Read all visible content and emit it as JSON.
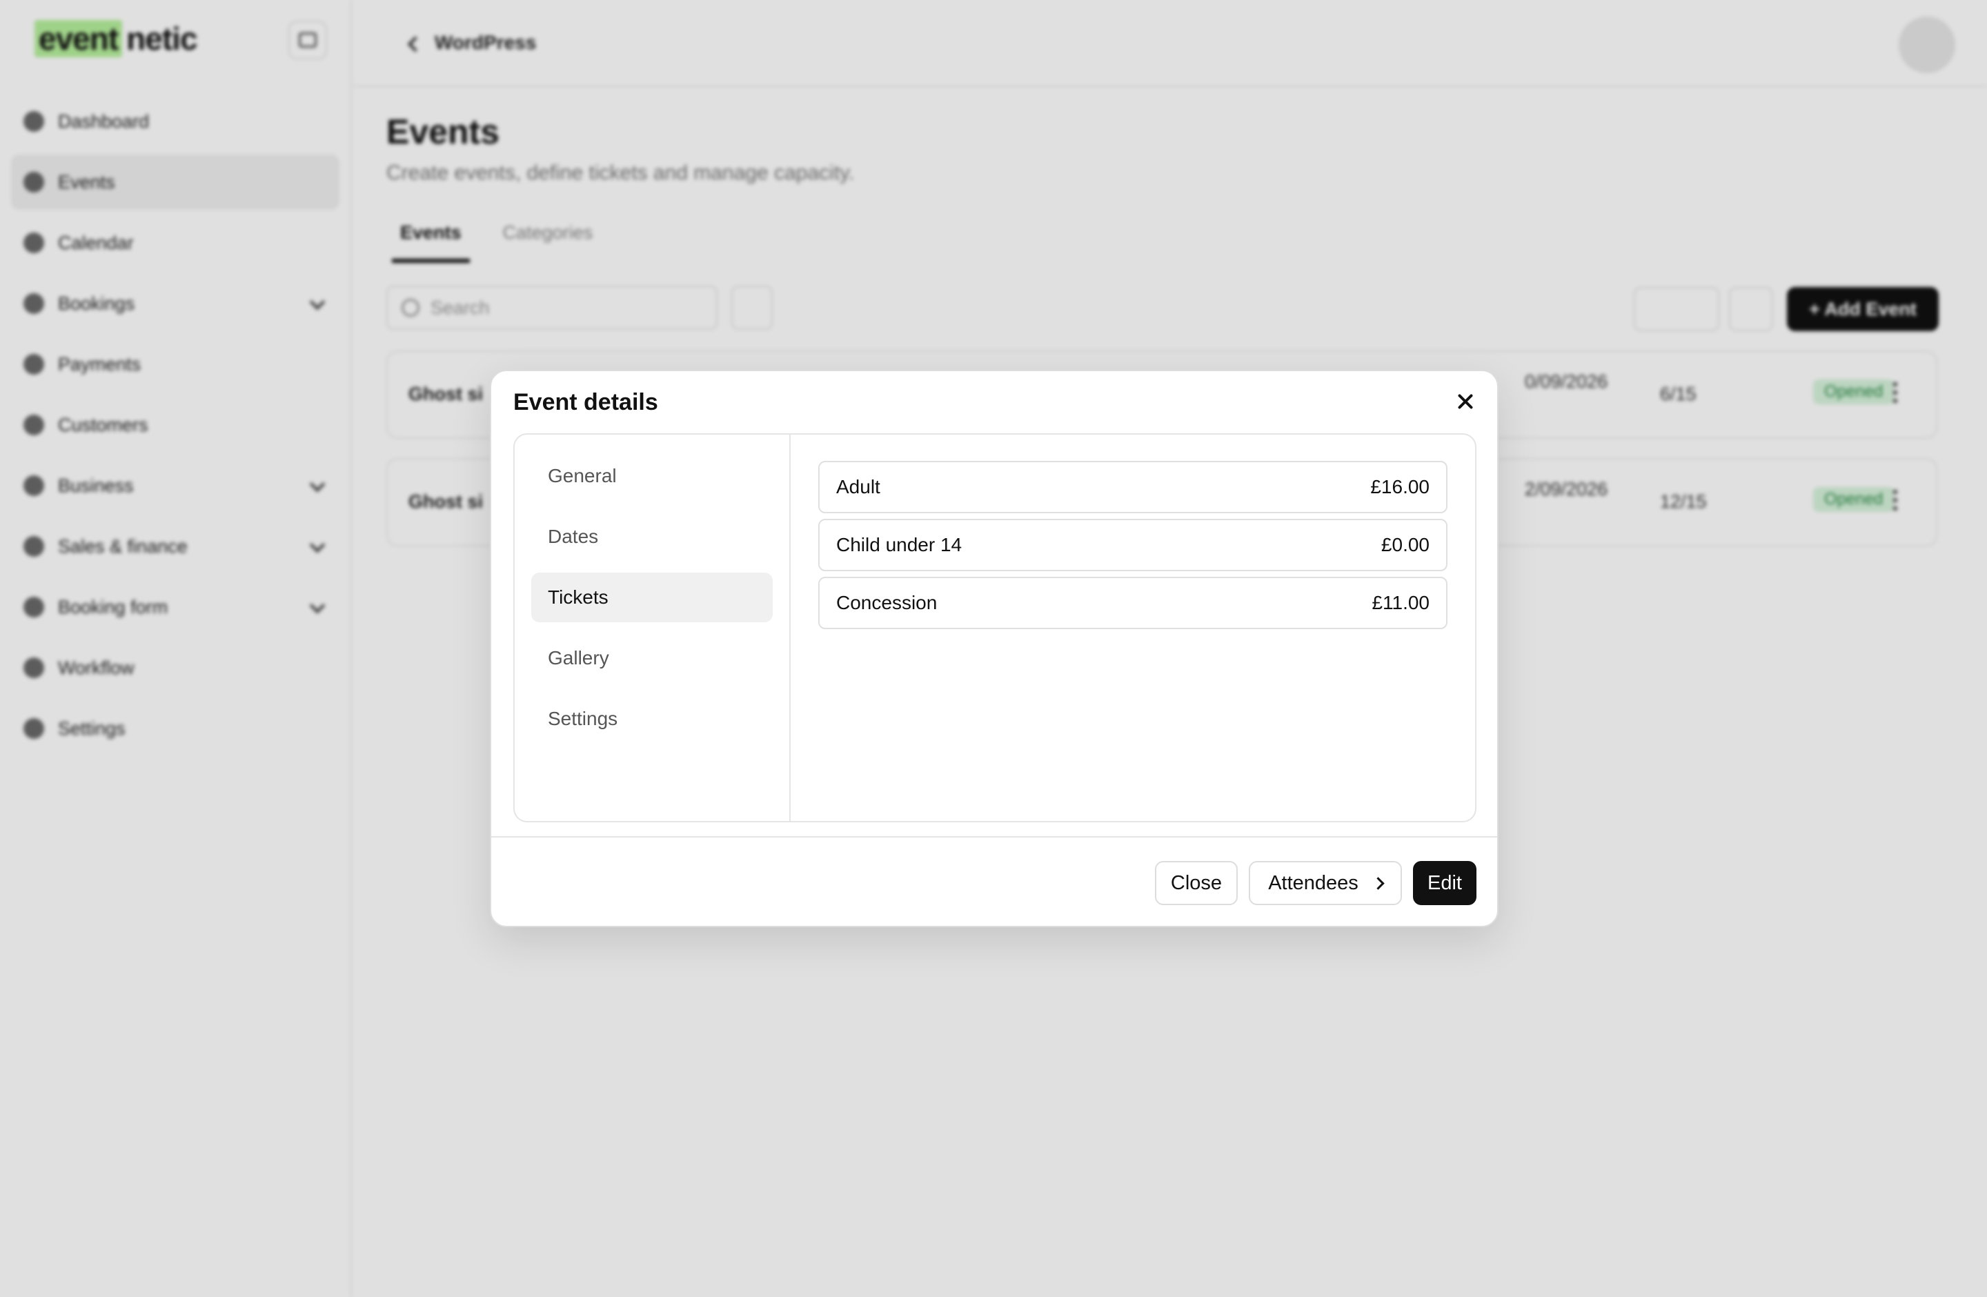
{
  "app": {
    "logo": {
      "part1": "event",
      "part2": "netic"
    },
    "sidebar": {
      "items": [
        {
          "label": "Dashboard",
          "icon": "dashboard-icon",
          "active": false,
          "expandable": false
        },
        {
          "label": "Events",
          "icon": "calendar-icon",
          "active": true,
          "expandable": false
        },
        {
          "label": "Calendar",
          "icon": "calendar-grid-icon",
          "active": false,
          "expandable": false
        },
        {
          "label": "Bookings",
          "icon": "bookings-icon",
          "active": false,
          "expandable": true
        },
        {
          "label": "Payments",
          "icon": "payments-icon",
          "active": false,
          "expandable": false
        },
        {
          "label": "Customers",
          "icon": "customers-icon",
          "active": false,
          "expandable": false
        },
        {
          "label": "Business",
          "icon": "business-icon",
          "active": false,
          "expandable": true
        },
        {
          "label": "Sales & finance",
          "icon": "finance-icon",
          "active": false,
          "expandable": true
        },
        {
          "label": "Booking form",
          "icon": "form-icon",
          "active": false,
          "expandable": true
        },
        {
          "label": "Workflow",
          "icon": "workflow-icon",
          "active": false,
          "expandable": false
        },
        {
          "label": "Settings",
          "icon": "settings-icon",
          "active": false,
          "expandable": false
        }
      ]
    },
    "topbar": {
      "back_label": "WordPress"
    },
    "page": {
      "title": "Events",
      "subtitle": "Create events, define tickets and manage capacity.",
      "tabs": [
        {
          "label": "Events",
          "active": true
        },
        {
          "label": "Categories",
          "active": false
        }
      ],
      "search_placeholder": "Search",
      "add_button": "+ Add Event",
      "rows": [
        {
          "name": "Ghost si",
          "date": "0/09/2026",
          "capacity": "6/15",
          "status": "Opened"
        },
        {
          "name": "Ghost si",
          "date": "2/09/2026",
          "capacity": "12/15",
          "status": "Opened"
        }
      ]
    }
  },
  "modal": {
    "title": "Event details",
    "nav": [
      {
        "label": "General",
        "active": false
      },
      {
        "label": "Dates",
        "active": false
      },
      {
        "label": "Tickets",
        "active": true
      },
      {
        "label": "Gallery",
        "active": false
      },
      {
        "label": "Settings",
        "active": false
      }
    ],
    "tickets": [
      {
        "name": "Adult",
        "price": "£16.00"
      },
      {
        "name": "Child under 14",
        "price": "£0.00"
      },
      {
        "name": "Concession",
        "price": "£11.00"
      }
    ],
    "footer": {
      "close_label": "Close",
      "attendees_label": "Attendees",
      "edit_label": "Edit"
    }
  }
}
